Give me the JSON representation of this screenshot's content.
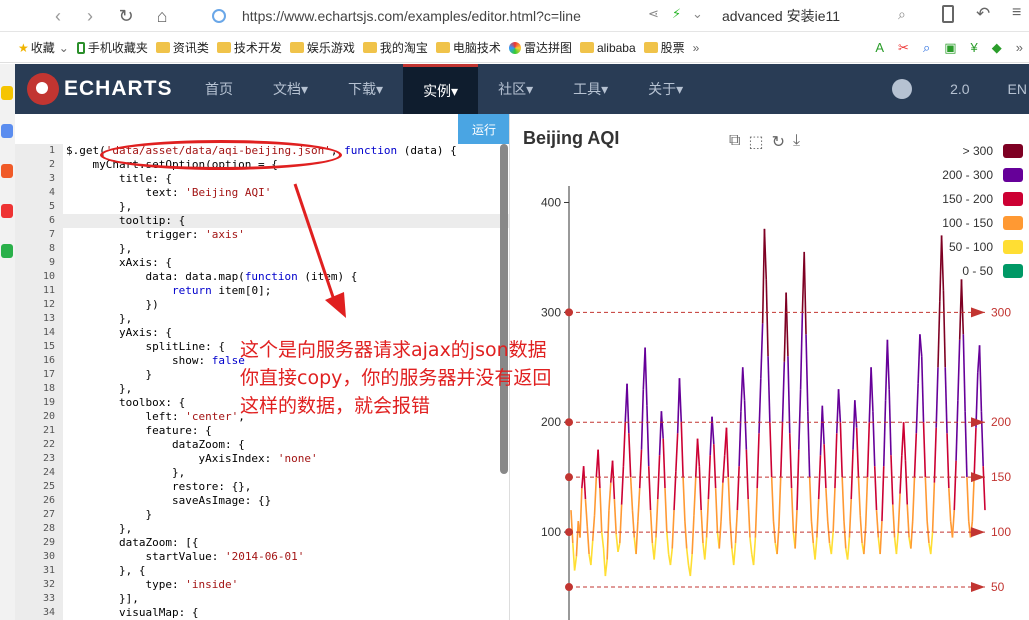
{
  "browser": {
    "url": "https://www.echartsjs.com/examples/editor.html?c=line",
    "search": "advanced 安装ie11",
    "bookmarks": [
      "收藏",
      "手机收藏夹",
      "资讯类",
      "技术开发",
      "娱乐游戏",
      "我的淘宝",
      "电脑技术",
      "雷达拼图",
      "alibaba",
      "股票"
    ],
    "bookmark_more": "»"
  },
  "header": {
    "logo": "ECHARTS",
    "nav": [
      "首页",
      "文档▾",
      "下载▾",
      "实例▾",
      "社区▾",
      "工具▾",
      "关于▾"
    ],
    "active_index": 3,
    "version": "2.0",
    "lang": "EN"
  },
  "editor": {
    "run_label": "运行",
    "highlight_line": 6,
    "lines": [
      "$.get('data/asset/data/aqi-beijing.json', function (data) {",
      "    myChart.setOption(option = {",
      "        title: {",
      "            text: 'Beijing AQI'",
      "        },",
      "        tooltip: {",
      "            trigger: 'axis'",
      "        },",
      "        xAxis: {",
      "            data: data.map(function (item) {",
      "                return item[0];",
      "            })",
      "        },",
      "        yAxis: {",
      "            splitLine: {",
      "                show: false",
      "            }",
      "        },",
      "        toolbox: {",
      "            left: 'center',",
      "            feature: {",
      "                dataZoom: {",
      "                    yAxisIndex: 'none'",
      "                },",
      "                restore: {},",
      "                saveAsImage: {}",
      "            }",
      "        },",
      "        dataZoom: [{",
      "            startValue: '2014-06-01'",
      "        }, {",
      "            type: 'inside'",
      "        }],",
      "        visualMap: {"
    ]
  },
  "annotation": {
    "lines": [
      "这个是向服务器请求ajax的json数据",
      "你直接copy，你的服务器并没有返回",
      "这样的数据，就会报错"
    ],
    "color": "#e02020"
  },
  "chart_data": {
    "type": "line",
    "title": "Beijing AQI",
    "yticks": [
      100,
      200,
      300,
      400
    ],
    "ylim": [
      20,
      415
    ],
    "markLines": [
      50,
      100,
      150,
      200,
      300
    ],
    "legend": [
      {
        "label": "> 300",
        "color": "#7e0023"
      },
      {
        "label": "200 - 300",
        "color": "#660099"
      },
      {
        "label": "150 - 200",
        "color": "#cc0033"
      },
      {
        "label": "100 - 150",
        "color": "#ff9933"
      },
      {
        "label": "50 - 100",
        "color": "#ffde33"
      },
      {
        "label": "0 - 50",
        "color": "#096"
      }
    ],
    "values": [
      120,
      90,
      65,
      78,
      110,
      95,
      140,
      160,
      130,
      105,
      80,
      70,
      92,
      115,
      150,
      175,
      140,
      100,
      85,
      60,
      75,
      120,
      145,
      165,
      130,
      98,
      82,
      90,
      125,
      160,
      200,
      235,
      190,
      150,
      120,
      95,
      80,
      110,
      140,
      175,
      230,
      268,
      215,
      160,
      120,
      90,
      75,
      95,
      130,
      170,
      210,
      185,
      140,
      100,
      80,
      70,
      85,
      120,
      155,
      190,
      240,
      200,
      150,
      110,
      85,
      70,
      60,
      80,
      115,
      150,
      185,
      160,
      120,
      90,
      75,
      95,
      130,
      170,
      205,
      180,
      140,
      100,
      85,
      110,
      145,
      170,
      195,
      150,
      110,
      85,
      70,
      90,
      120,
      160,
      210,
      250,
      220,
      175,
      130,
      95,
      80,
      70,
      95,
      140,
      190,
      240,
      290,
      376,
      330,
      260,
      200,
      150,
      110,
      90,
      80,
      105,
      150,
      200,
      255,
      318,
      260,
      190,
      140,
      100,
      85,
      120,
      175,
      230,
      300,
      355,
      280,
      210,
      150,
      110,
      90,
      75,
      95,
      130,
      170,
      215,
      180,
      140,
      110,
      90,
      80,
      100,
      140,
      190,
      230,
      200,
      150,
      110,
      85,
      75,
      95,
      130,
      175,
      220,
      195,
      150,
      115,
      90,
      80,
      105,
      150,
      200,
      250,
      210,
      160,
      120,
      95,
      80,
      110,
      160,
      220,
      275,
      230,
      170,
      125,
      95,
      80,
      100,
      135,
      170,
      200,
      165,
      125,
      95,
      85,
      110,
      150,
      190,
      235,
      280,
      260,
      200,
      150,
      110,
      90,
      80,
      100,
      145,
      195,
      250,
      310,
      370,
      320,
      250,
      190,
      140,
      110,
      95,
      120,
      165,
      220,
      275,
      330,
      280,
      210,
      150,
      110,
      95,
      110,
      150,
      195,
      245,
      270,
      210,
      160,
      120
    ]
  }
}
